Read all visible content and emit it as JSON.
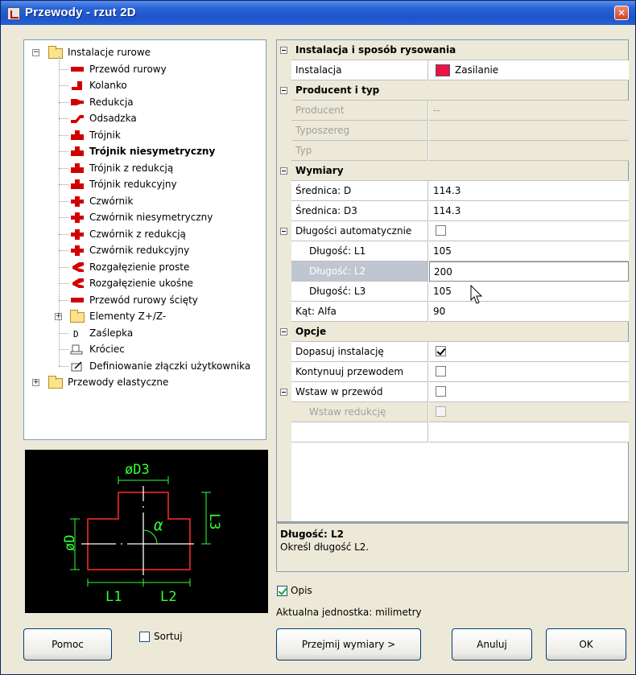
{
  "window": {
    "title": "Przewody - rzut 2D",
    "close_glyph": "✕"
  },
  "tree": [
    {
      "label": "Instalacje rurowe",
      "icon": "folder-icon",
      "level": 0,
      "expander": "−",
      "selected": false
    },
    {
      "label": "Przewód rurowy",
      "icon": "pipe-straight-icon",
      "level": 1
    },
    {
      "label": "Kolanko",
      "icon": "pipe-elbow-icon",
      "level": 1
    },
    {
      "label": "Redukcja",
      "icon": "pipe-reduction-icon",
      "level": 1
    },
    {
      "label": "Odsadzka",
      "icon": "pipe-offset-icon",
      "level": 1
    },
    {
      "label": "Trójnik",
      "icon": "tee-icon",
      "level": 1
    },
    {
      "label": "Trójnik niesymetryczny",
      "icon": "tee-icon",
      "level": 1,
      "selected": true
    },
    {
      "label": "Trójnik z redukcją",
      "icon": "tee-icon",
      "level": 1
    },
    {
      "label": "Trójnik redukcyjny",
      "icon": "tee-icon",
      "level": 1
    },
    {
      "label": "Czwórnik",
      "icon": "cross-icon",
      "level": 1
    },
    {
      "label": "Czwórnik niesymetryczny",
      "icon": "cross-icon",
      "level": 1
    },
    {
      "label": "Czwórnik z redukcją",
      "icon": "cross-icon",
      "level": 1
    },
    {
      "label": "Czwórnik redukcyjny",
      "icon": "cross-icon",
      "level": 1
    },
    {
      "label": "Rozgałęzienie proste",
      "icon": "branch-icon",
      "level": 1
    },
    {
      "label": "Rozgałęzienie ukośne",
      "icon": "branch-icon",
      "level": 1
    },
    {
      "label": "Przewód rurowy ścięty",
      "icon": "pipe-straight-icon",
      "level": 1
    },
    {
      "label": "Elementy Z+/Z-",
      "icon": "folder-icon",
      "level": 1,
      "expander": "+"
    },
    {
      "label": "Zaślepka",
      "icon": "cap-icon",
      "level": 1
    },
    {
      "label": "Króciec",
      "icon": "stub-icon",
      "level": 1
    },
    {
      "label": "Definiowanie złączki użytkownika",
      "icon": "define-fitting-icon",
      "level": 1
    },
    {
      "label": "Przewody elastyczne",
      "icon": "folder-icon",
      "level": 0,
      "expander": "+"
    }
  ],
  "preview": {
    "labels": {
      "d3": "øD3",
      "d": "øD",
      "l3": "L3",
      "l1": "L1",
      "l2": "L2",
      "alpha": "α"
    }
  },
  "properties": {
    "cat_install": "Instalacja i sposób rysowania",
    "installation_label": "Instalacja",
    "installation_value": "Zasilanie",
    "installation_color": "#ee1144",
    "cat_producer": "Producent i typ",
    "producer_label": "Producent",
    "producer_value": "--",
    "series_label": "Typoszereg",
    "type_label": "Typ",
    "cat_dims": "Wymiary",
    "d_label": "Średnica: D",
    "d_value": "114.3",
    "d3_label": "Średnica: D3",
    "d3_value": "114.3",
    "autolen_label": "Długości automatycznie",
    "autolen_checked": false,
    "l1_label": "Długość: L1",
    "l1_value": "105",
    "l2_label": "Długość: L2",
    "l2_value": "200",
    "l3_label": "Długość: L3",
    "l3_value": "105",
    "alpha_label": "Kąt: Alfa",
    "alpha_value": "90",
    "cat_options": "Opcje",
    "fit_label": "Dopasuj instalację",
    "fit_checked": true,
    "continue_label": "Kontynuuj przewodem",
    "continue_checked": false,
    "insert_label": "Wstaw w przewód",
    "insert_checked": false,
    "insert_red_label": "Wstaw redukcję",
    "insert_red_checked": false
  },
  "description": {
    "title": "Długość: L2",
    "text": "Określ długość L2."
  },
  "opis": {
    "label": "Opis",
    "checked": true
  },
  "unit_text": "Aktualna jednostka: milimetry",
  "sort": {
    "label": "Sortuj",
    "checked": false
  },
  "buttons": {
    "help": "Pomoc",
    "take_dims": "Przejmij wymiary >",
    "cancel": "Anuluj",
    "ok": "OK"
  }
}
